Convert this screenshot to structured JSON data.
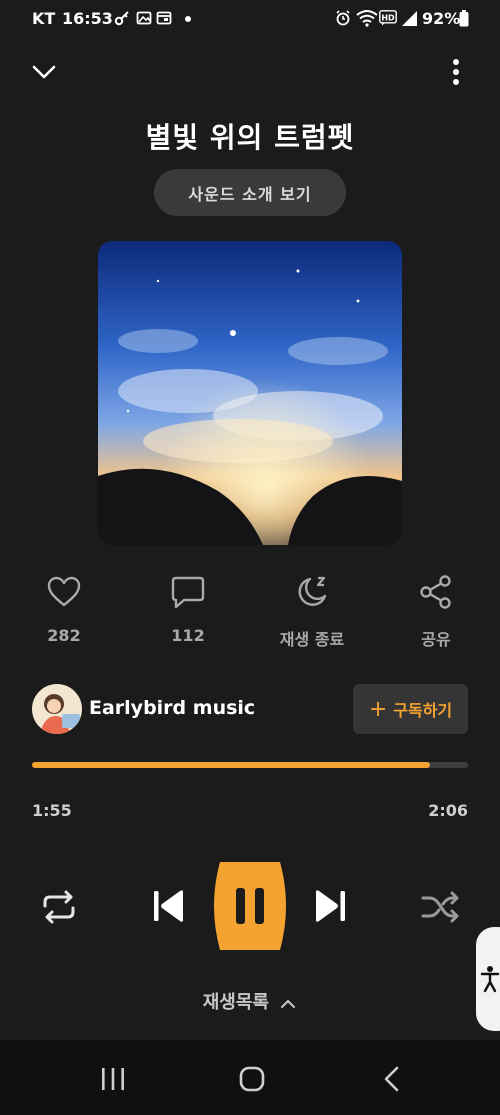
{
  "status_bar": {
    "carrier": "KT",
    "time": "16:53",
    "battery": "92%",
    "icons_left": [
      "key-icon",
      "image-icon",
      "calendar-icon",
      "dot-icon"
    ],
    "icons_right": [
      "alarm-icon",
      "wifi-icon",
      "hd-icon",
      "signal-icon",
      "battery-icon"
    ]
  },
  "header": {
    "title": "별빛 위의 트럼펫",
    "intro_button": "사운드 소개 보기"
  },
  "actions": [
    {
      "icon": "heart-icon",
      "label": "282"
    },
    {
      "icon": "comment-icon",
      "label": "112"
    },
    {
      "icon": "sleep-timer-icon",
      "label": "재생 종료"
    },
    {
      "icon": "share-icon",
      "label": "공유"
    }
  ],
  "artist": {
    "name": "Earlybird music",
    "subscribe_plus": "+",
    "subscribe_label": "구독하기"
  },
  "player": {
    "current_time": "1:55",
    "total_time": "2:06",
    "progress": 0.9127,
    "playlist_label": "재생목록"
  },
  "colors": {
    "background": "#1b1b1b",
    "accent": "#f4a230",
    "track": "#3d3d3d",
    "muted_text": "#a9a9a9"
  }
}
